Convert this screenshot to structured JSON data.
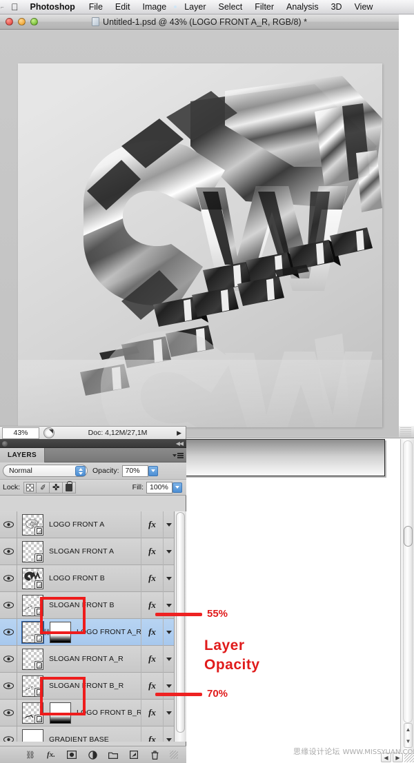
{
  "menubar": {
    "apple_icon": "apple-logo",
    "items": [
      {
        "label": "Photoshop",
        "bold": true
      },
      {
        "label": "File"
      },
      {
        "label": "Edit"
      },
      {
        "label": "Image"
      },
      {
        "label": "Layer"
      },
      {
        "label": "Select"
      },
      {
        "label": "Filter"
      },
      {
        "label": "Analysis"
      },
      {
        "label": "3D"
      },
      {
        "label": "View"
      }
    ]
  },
  "document": {
    "title": "Untitled-1.psd @ 43% (LOGO FRONT A_R, RGB/8) *",
    "window_buttons": [
      "close",
      "minimize",
      "zoom"
    ]
  },
  "status_bar": {
    "zoom": "43%",
    "doc_info": "Doc: 4,12M/27,1M",
    "arrow": "▶"
  },
  "layers_panel": {
    "tab_label": "LAYERS",
    "blend_mode": "Normal",
    "opacity_label": "Opacity:",
    "opacity_value": "70%",
    "fill_label": "Fill:",
    "fill_value": "100%",
    "lock_label": "Lock:",
    "lock_buttons": [
      "lock-transparent-pixels",
      "lock-image-pixels",
      "lock-position",
      "lock-all"
    ],
    "rows": [
      {
        "name": "LOGO FRONT A",
        "visible": true,
        "fx": "fx",
        "selected": false,
        "has_mask": false,
        "thumb": "logo-a"
      },
      {
        "name": "SLOGAN FRONT A",
        "visible": true,
        "fx": "fx",
        "selected": false,
        "has_mask": false,
        "thumb": "slogan-a"
      },
      {
        "name": "LOGO FRONT B",
        "visible": true,
        "fx": "fx",
        "selected": false,
        "has_mask": false,
        "thumb": "logo-b"
      },
      {
        "name": "SLOGAN FRONT B",
        "visible": true,
        "fx": "fx",
        "selected": false,
        "has_mask": false,
        "thumb": "slogan-b"
      },
      {
        "name": "LOGO FRONT A_R",
        "visible": true,
        "fx": "fx",
        "selected": true,
        "has_mask": true,
        "thumb": "logo-a-r"
      },
      {
        "name": "SLOGAN FRONT A_R",
        "visible": true,
        "fx": "fx",
        "selected": false,
        "has_mask": false,
        "thumb": "slogan-a-r"
      },
      {
        "name": "SLOGAN FRONT B_R",
        "visible": true,
        "fx": "fx",
        "selected": false,
        "has_mask": false,
        "thumb": "slogan-b-r"
      },
      {
        "name": "LOGO FRONT B_R",
        "visible": true,
        "fx": "fx",
        "selected": false,
        "has_mask": true,
        "thumb": "logo-b-r"
      },
      {
        "name": "GRADIENT BASE",
        "visible": true,
        "fx": "fx",
        "selected": false,
        "has_mask": false,
        "thumb": "gradient-base"
      }
    ],
    "footer_icons": [
      "link-layers",
      "add-layer-style",
      "add-layer-mask",
      "new-adjustment-layer",
      "new-group",
      "new-layer",
      "delete-layer"
    ]
  },
  "annotations": {
    "callout_top": "55%",
    "callout_bottom": "70%",
    "title_line1": "Layer",
    "title_line2": "Opacity",
    "color": "#ee1c1c"
  },
  "watermark": {
    "text": "思缘设计论坛",
    "url": "WWW.MISSYUAN.COM"
  },
  "background_window": {
    "scroll_arrows_up": "▲",
    "scroll_arrows_down": "▼",
    "hscroll_left": "◀",
    "hscroll_right": "▶"
  }
}
